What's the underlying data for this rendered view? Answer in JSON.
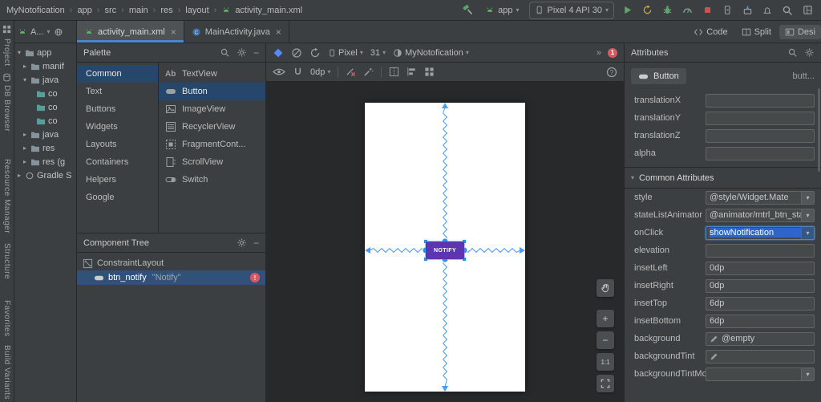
{
  "icons": {
    "chevron_down": "▾",
    "chevron_right": "▸",
    "breadcrumb_sep": "›",
    "overflow": "»",
    "minus": "−",
    "close": "×",
    "error_mark": "!",
    "error_count": "1",
    "help_mark": "?"
  },
  "titlebar": {
    "project": "MyNotofication",
    "breadcrumbs": [
      "app",
      "src",
      "main",
      "res",
      "layout",
      "activity_main.xml"
    ],
    "run_config": "app",
    "device": "Pixel 4 API 30"
  },
  "tabs": {
    "tab1": "activity_main.xml",
    "tab2": "MainActivity.java"
  },
  "view_modes": {
    "code": "Code",
    "split": "Split",
    "design": "Desi"
  },
  "tool_windows": {
    "project": "Project",
    "db_browser": "DB Browser",
    "resource_manager": "Resource Manager",
    "structure": "Structure",
    "favorites": "Favorites",
    "build_variants": "Build Variants"
  },
  "project_panel": {
    "view_selector": "A...",
    "tree": [
      {
        "label": "app"
      },
      {
        "label": "manif"
      },
      {
        "label": "java"
      },
      {
        "label": "co"
      },
      {
        "label": "co"
      },
      {
        "label": "co"
      },
      {
        "label": "java"
      },
      {
        "label": "res"
      },
      {
        "label": "res (g"
      },
      {
        "label": "Gradle S"
      }
    ]
  },
  "palette": {
    "title": "Palette",
    "categories": [
      "Common",
      "Text",
      "Buttons",
      "Widgets",
      "Layouts",
      "Containers",
      "Helpers",
      "Google"
    ],
    "selected_category": "Common",
    "components": [
      {
        "label": "TextView"
      },
      {
        "label": "Button"
      },
      {
        "label": "ImageView"
      },
      {
        "label": "RecyclerView"
      },
      {
        "label": "FragmentCont..."
      },
      {
        "label": "ScrollView"
      },
      {
        "label": "Switch"
      }
    ],
    "selected_component": "Button"
  },
  "component_tree": {
    "title": "Component Tree",
    "root": "ConstraintLayout",
    "selected": "btn_notify",
    "selected_value": "\"Notify\""
  },
  "design_toolbar": {
    "device": "Pixel",
    "api": "31",
    "theme": "MyNotofication",
    "margin": "0dp"
  },
  "canvas": {
    "button_label": "NOTIFY",
    "zoom_label": "1:1"
  },
  "attributes": {
    "title": "Attributes",
    "component": "Button",
    "component_id": "butt...",
    "rows": [
      {
        "label": "translationX",
        "value": ""
      },
      {
        "label": "translationY",
        "value": ""
      },
      {
        "label": "translationZ",
        "value": ""
      },
      {
        "label": "alpha",
        "value": ""
      }
    ],
    "section": "Common Attributes",
    "common": [
      {
        "label": "style",
        "value": "@style/Widget.Mate"
      },
      {
        "label": "stateListAnimator",
        "value": "@animator/mtrl_btn_stat"
      },
      {
        "label": "onClick",
        "value": "showNotification"
      },
      {
        "label": "elevation",
        "value": ""
      },
      {
        "label": "insetLeft",
        "value": "0dp"
      },
      {
        "label": "insetRight",
        "value": "0dp"
      },
      {
        "label": "insetTop",
        "value": "6dp"
      },
      {
        "label": "insetBottom",
        "value": "6dp"
      },
      {
        "label": "background",
        "value": "@empty"
      },
      {
        "label": "backgroundTint",
        "value": ""
      },
      {
        "label": "backgroundTintMo...",
        "value": ""
      }
    ]
  }
}
